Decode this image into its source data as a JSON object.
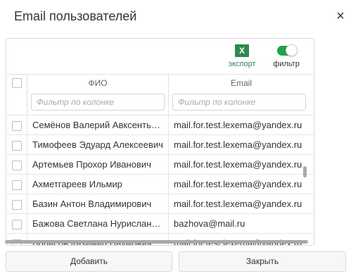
{
  "dialog": {
    "title": "Email пользователей",
    "close_icon": "×"
  },
  "toolbar": {
    "export_icon_text": "X",
    "export_label": "экспорт",
    "filter_label": "фильтр",
    "filter_enabled": true,
    "accent_color": "#21a14a"
  },
  "columns": {
    "fio": "ФИО",
    "email": "Email"
  },
  "filters": {
    "fio_placeholder": "Фильтр по колонке",
    "email_placeholder": "Фильтр по колонке"
  },
  "rows": [
    {
      "fio": "Семёнов Валерий Авксентьевич",
      "email": "mail.for.test.lexema@yandex.ru"
    },
    {
      "fio": "Тимофеев Эдуард Алексеевич",
      "email": "mail.for.test.lexema@yandex.ru"
    },
    {
      "fio": "Артемьев Прохор Иванович",
      "email": "mail.for.test.lexema@yandex.ru"
    },
    {
      "fio": "Ахметгареев Ильмир",
      "email": "mail.for.test.lexema@yandex.ru"
    },
    {
      "fio": "Базин Антон Владимирович",
      "email": "mail.for.test.lexema@yandex.ru"
    },
    {
      "fio": "Бажова Светлана Нурислановна",
      "email": "bazhova@mail.ru"
    },
    {
      "fio": "Борисов Казимир Наумович",
      "email": "mail.for.test.lexema@yandex.ru"
    }
  ],
  "buttons": {
    "add": "Добавить",
    "close": "Закрыть"
  }
}
